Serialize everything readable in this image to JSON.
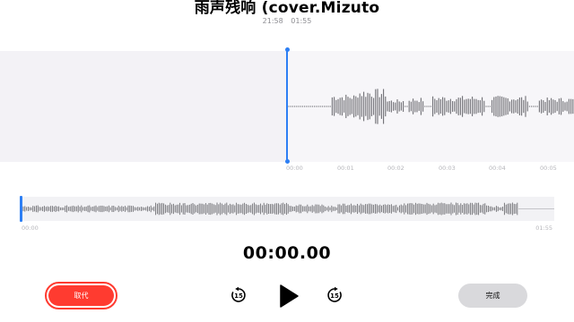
{
  "recording": {
    "title": "雨声残响 (cover.Mizuto",
    "date": "21:58",
    "duration": "01:55"
  },
  "waveform": {
    "time_labels": [
      "00:00",
      "00:01",
      "00:02",
      "00:03",
      "00:04",
      "00:05"
    ]
  },
  "overview": {
    "start_label": "00:00",
    "end_label": "01:55"
  },
  "player": {
    "current_time": "00:00.00",
    "skip_back_seconds": "15",
    "skip_forward_seconds": "15"
  },
  "buttons": {
    "replace_label": "取代",
    "done_label": "完成"
  },
  "colors": {
    "accent": "#2d7ff4",
    "record_red": "#ff3b30",
    "waveform": "#6e6e73"
  }
}
